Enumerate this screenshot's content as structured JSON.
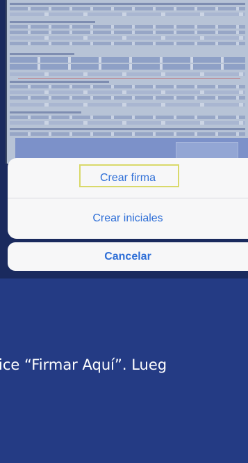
{
  "action_sheet": {
    "create_signature_label": "Crear firma",
    "create_initials_label": "Crear iniciales",
    "cancel_label": "Cancelar"
  },
  "caption": {
    "text": "ice “Firmar Aquí”. Lueg"
  },
  "colors": {
    "background": "#243b84",
    "action_text": "#2f6fd7",
    "highlight": "#d9d96a"
  }
}
